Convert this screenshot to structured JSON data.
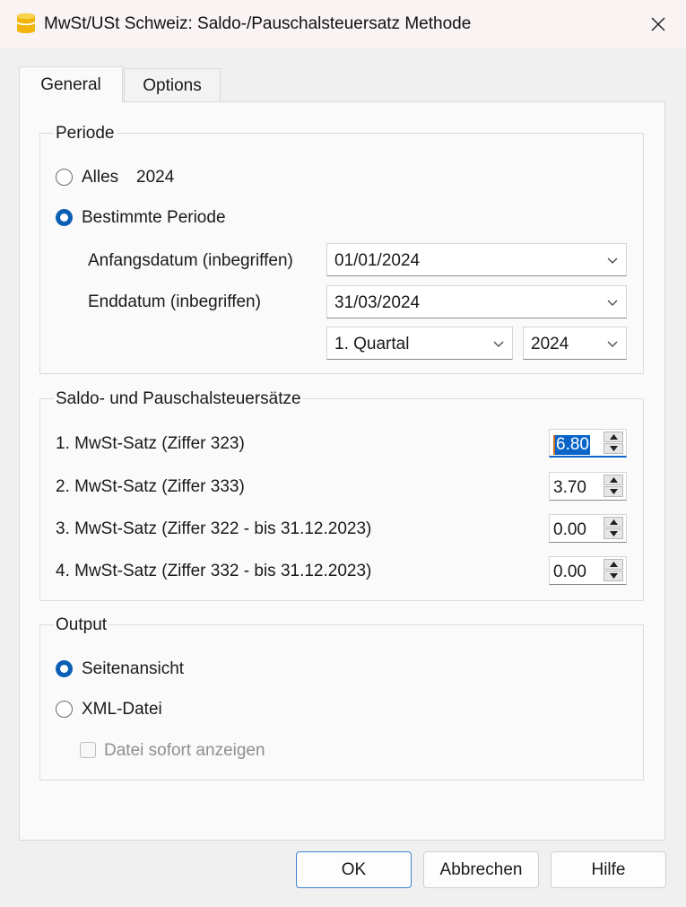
{
  "window": {
    "title": "MwSt/USt Schweiz: Saldo-/Pauschalsteuersatz Methode",
    "app_icon": "database-cylinder-icon",
    "accent": "#f2b50d"
  },
  "tabs": [
    {
      "label": "General",
      "active": true
    },
    {
      "label": "Options",
      "active": false
    }
  ],
  "periode": {
    "title": "Periode",
    "alles_label": "Alles",
    "alles_year": "2024",
    "bestimmte_label": "Bestimmte Periode",
    "selected": "Bestimmte Periode",
    "anfang_label": "Anfangsdatum (inbegriffen)",
    "anfang_value": "01/01/2024",
    "end_label": "Enddatum (inbegriffen)",
    "end_value": "31/03/2024",
    "quartal_value": "1. Quartal",
    "year_value": "2024"
  },
  "rates": {
    "title": "Saldo- und Pauschalsteuersätze",
    "items": [
      {
        "label": "1. MwSt-Satz (Ziffer 323)",
        "value": "6.80"
      },
      {
        "label": "2. MwSt-Satz (Ziffer 333)",
        "value": "3.70"
      },
      {
        "label": "3. MwSt-Satz (Ziffer 322 - bis 31.12.2023)",
        "value": "0.00"
      },
      {
        "label": "4. MwSt-Satz (Ziffer 332 - bis 31.12.2023)",
        "value": "0.00"
      }
    ]
  },
  "output": {
    "title": "Output",
    "seitenansicht_label": "Seitenansicht",
    "xml_label": "XML-Datei",
    "selected": "Seitenansicht",
    "datei_label": "Datei sofort anzeigen",
    "datei_checked": false
  },
  "buttons": {
    "ok": "OK",
    "cancel": "Abbrechen",
    "help": "Hilfe"
  },
  "colors": {
    "radio_selected": "#0a5fb4",
    "selection": "#0a64c8",
    "primary_border": "#3a82d6"
  }
}
